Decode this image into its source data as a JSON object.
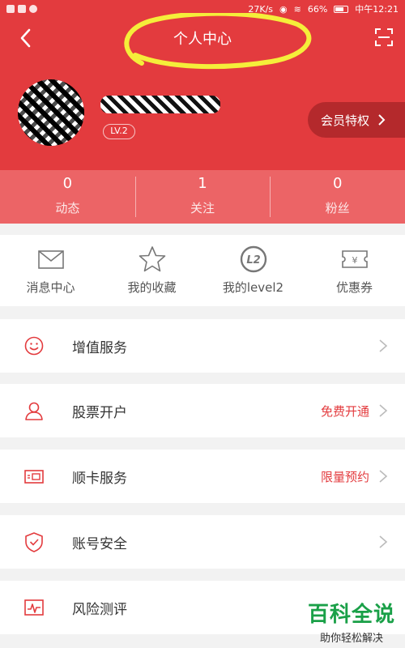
{
  "status_bar": {
    "network_speed": "27K/s",
    "battery": "66%",
    "time": "中午12:21"
  },
  "header": {
    "title": "个人中心",
    "level": "LV.2",
    "vip_label": "会员特权"
  },
  "stats": [
    {
      "value": "0",
      "label": "动态"
    },
    {
      "value": "1",
      "label": "关注"
    },
    {
      "value": "0",
      "label": "粉丝"
    }
  ],
  "quick": [
    {
      "label": "消息中心",
      "icon": "envelope-icon"
    },
    {
      "label": "我的收藏",
      "icon": "star-icon"
    },
    {
      "label": "我的level2",
      "icon": "level2-icon"
    },
    {
      "label": "优惠券",
      "icon": "coupon-icon"
    }
  ],
  "menu": [
    {
      "label": "增值服务",
      "extra": "",
      "icon": "smile-icon"
    },
    {
      "label": "股票开户",
      "extra": "免费开通",
      "icon": "person-icon"
    },
    {
      "label": "顺卡服务",
      "extra": "限量预约",
      "icon": "card-icon"
    },
    {
      "label": "账号安全",
      "extra": "",
      "icon": "shield-icon"
    },
    {
      "label": "风险测评",
      "extra": "",
      "icon": "pulse-icon"
    }
  ],
  "watermark": {
    "title": "百科全说",
    "subtitle": "助你轻松解决"
  },
  "colors": {
    "brand_red": "#e33b3e",
    "stats_red": "#ec6466",
    "vip_dark_red": "#b4292c",
    "highlight_yellow": "#f5ee3a",
    "watermark_green": "#1aa048"
  }
}
